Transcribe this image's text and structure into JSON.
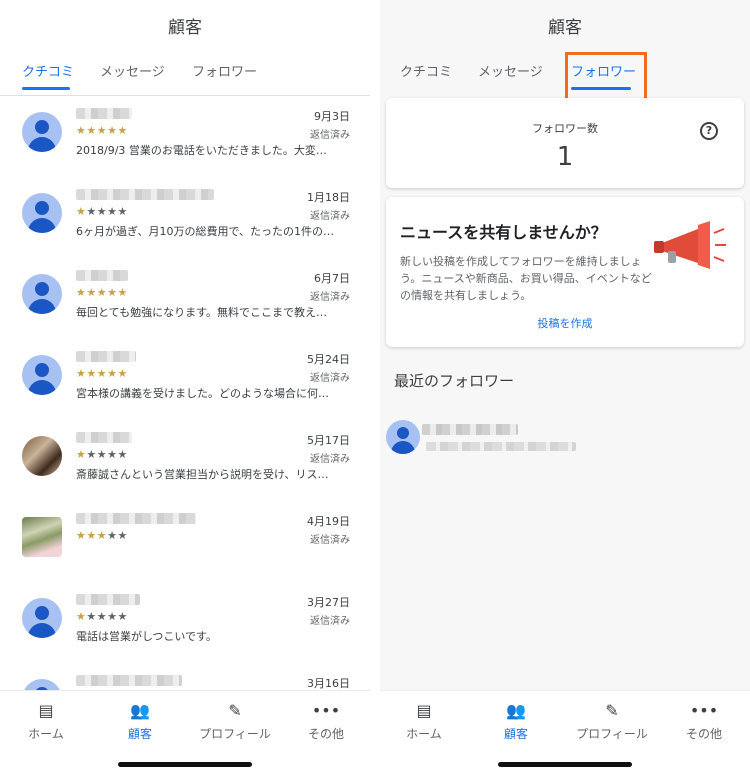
{
  "left": {
    "title": "顧客",
    "tabs": [
      {
        "label": "クチコミ",
        "active": true
      },
      {
        "label": "メッセージ",
        "active": false
      },
      {
        "label": "フォロワー",
        "active": false
      }
    ],
    "reviews": [
      {
        "date": "9月3日",
        "stars": "★★★★★",
        "dim_stars": "",
        "status": "返信済み",
        "snippet": "2018/9/3 営業のお電話をいただきました。大変…",
        "avatar": "default"
      },
      {
        "date": "1月18日",
        "stars": "★",
        "dim_stars": "★★★★",
        "status": "返信済み",
        "snippet": "6ヶ月が過ぎ、月10万の総費用で、たったの1件の…",
        "avatar": "default"
      },
      {
        "date": "6月7日",
        "stars": "★★★★★",
        "dim_stars": "",
        "status": "返信済み",
        "snippet": "毎回とても勉強になります。無料でここまで教え…",
        "avatar": "default"
      },
      {
        "date": "5月24日",
        "stars": "★★★★★",
        "dim_stars": "",
        "status": "返信済み",
        "snippet": "宮本様の講義を受けました。どのような場合に何…",
        "avatar": "default"
      },
      {
        "date": "5月17日",
        "stars": "★",
        "dim_stars": "★★★★",
        "status": "返信済み",
        "snippet": "斎藤誠さんという営業担当から説明を受け、リス…",
        "avatar": "photo1"
      },
      {
        "date": "4月19日",
        "stars": "★★★",
        "dim_stars": "★★",
        "status": "返信済み",
        "snippet": "",
        "avatar": "photo2"
      },
      {
        "date": "3月27日",
        "stars": "★",
        "dim_stars": "★★★★",
        "status": "返信済み",
        "snippet": "電話は営業がしつこいです。",
        "avatar": "default"
      },
      {
        "date": "3月16日",
        "stars": "",
        "dim_stars": "",
        "status": "",
        "snippet": "",
        "avatar": "default"
      }
    ],
    "nav": [
      {
        "label": "ホーム",
        "icon": "store-icon",
        "glyph": "▤",
        "active": false
      },
      {
        "label": "顧客",
        "icon": "people-icon",
        "glyph": "👥",
        "active": true
      },
      {
        "label": "プロフィール",
        "icon": "pencil-icon",
        "glyph": "✎",
        "active": false
      },
      {
        "label": "その他",
        "icon": "more-icon",
        "glyph": "•••",
        "active": false
      }
    ]
  },
  "right": {
    "title": "顧客",
    "tabs": [
      {
        "label": "クチコミ",
        "active": false
      },
      {
        "label": "メッセージ",
        "active": false
      },
      {
        "label": "フォロワー",
        "active": true
      }
    ],
    "followers_card": {
      "label": "フォロワー数",
      "count": "1",
      "help_glyph": "?"
    },
    "news_card": {
      "title": "ニュースを共有しませんか？",
      "body": "新しい投稿を作成してフォロワーを維持しましょう。ニュースや新商品、お買い得品、イベントなどの情報を共有しましょう。",
      "link": "投稿を作成"
    },
    "recent_title": "最近のフォロワー",
    "nav": [
      {
        "label": "ホーム",
        "icon": "store-icon",
        "glyph": "▤",
        "active": false
      },
      {
        "label": "顧客",
        "icon": "people-icon",
        "glyph": "👥",
        "active": true
      },
      {
        "label": "プロフィール",
        "icon": "pencil-icon",
        "glyph": "✎",
        "active": false
      },
      {
        "label": "その他",
        "icon": "more-icon",
        "glyph": "•••",
        "active": false
      }
    ]
  },
  "colors": {
    "accent": "#1a73e8",
    "highlight": "#f26b21",
    "star": "#c8a14a"
  }
}
